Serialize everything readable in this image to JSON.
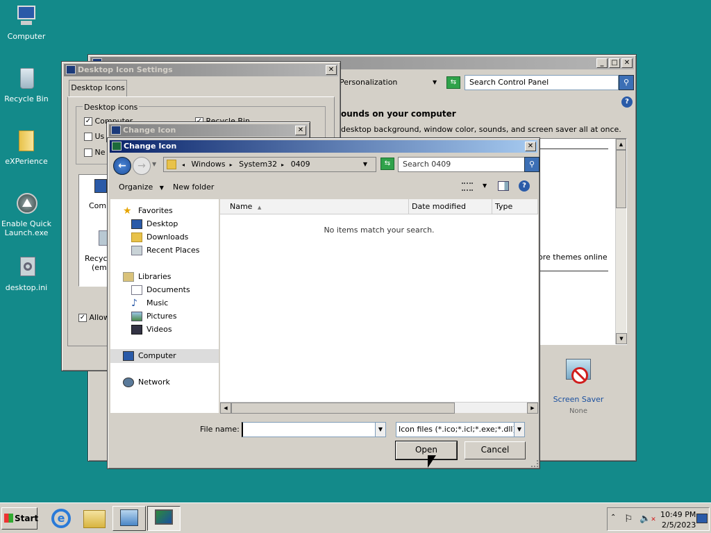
{
  "desktop_icons": [
    {
      "label": "Computer",
      "icon": "computer-icon"
    },
    {
      "label": "Recycle Bin",
      "icon": "recycle-bin-icon"
    },
    {
      "label": "eXPerience",
      "icon": "folder-icon"
    },
    {
      "label": "Enable Quick Launch.exe",
      "icon": "app-icon"
    },
    {
      "label": "desktop.ini",
      "icon": "settings-file-icon"
    }
  ],
  "personalization": {
    "breadcrumb": "Personalization",
    "search_placeholder": "Search Control Panel",
    "heading": "ounds on your computer",
    "subtext": "desktop background, window color, sounds, and screen saver all at once.",
    "themes_link": "ore themes online",
    "screen_saver_label": "Screen Saver",
    "screen_saver_value": "None"
  },
  "desktop_icon_settings": {
    "title": "Desktop Icon Settings",
    "tab": "Desktop Icons",
    "group": "Desktop icons",
    "checkboxes": [
      {
        "label": "Computer",
        "checked": true
      },
      {
        "label": "Recycle Bin",
        "checked": true
      },
      {
        "label": "Us",
        "checked": false
      },
      {
        "label": "Ne",
        "checked": false
      }
    ],
    "icon_labels": [
      "Comp",
      "Recyc",
      "(emp"
    ],
    "allow_label": "Allow"
  },
  "change_icon_bg": {
    "title": "Change Icon"
  },
  "change_icon": {
    "title": "Change Icon",
    "path": [
      "Windows",
      "System32",
      "0409"
    ],
    "search_placeholder": "Search 0409",
    "organize": "Organize",
    "new_folder": "New folder",
    "favorites": [
      "Favorites",
      "Desktop",
      "Downloads",
      "Recent Places"
    ],
    "libraries": [
      "Libraries",
      "Documents",
      "Music",
      "Pictures",
      "Videos"
    ],
    "computer": "Computer",
    "network": "Network",
    "columns": [
      "Name",
      "Date modified",
      "Type"
    ],
    "empty_message": "No items match your search.",
    "file_name_label": "File name:",
    "file_name_value": "",
    "file_type": "Icon files (*.ico;*.icl;*.exe;*.dll)",
    "open_button": "Open",
    "cancel_button": "Cancel"
  },
  "taskbar": {
    "start": "Start",
    "time": "10:49 PM",
    "date": "2/5/2023"
  }
}
